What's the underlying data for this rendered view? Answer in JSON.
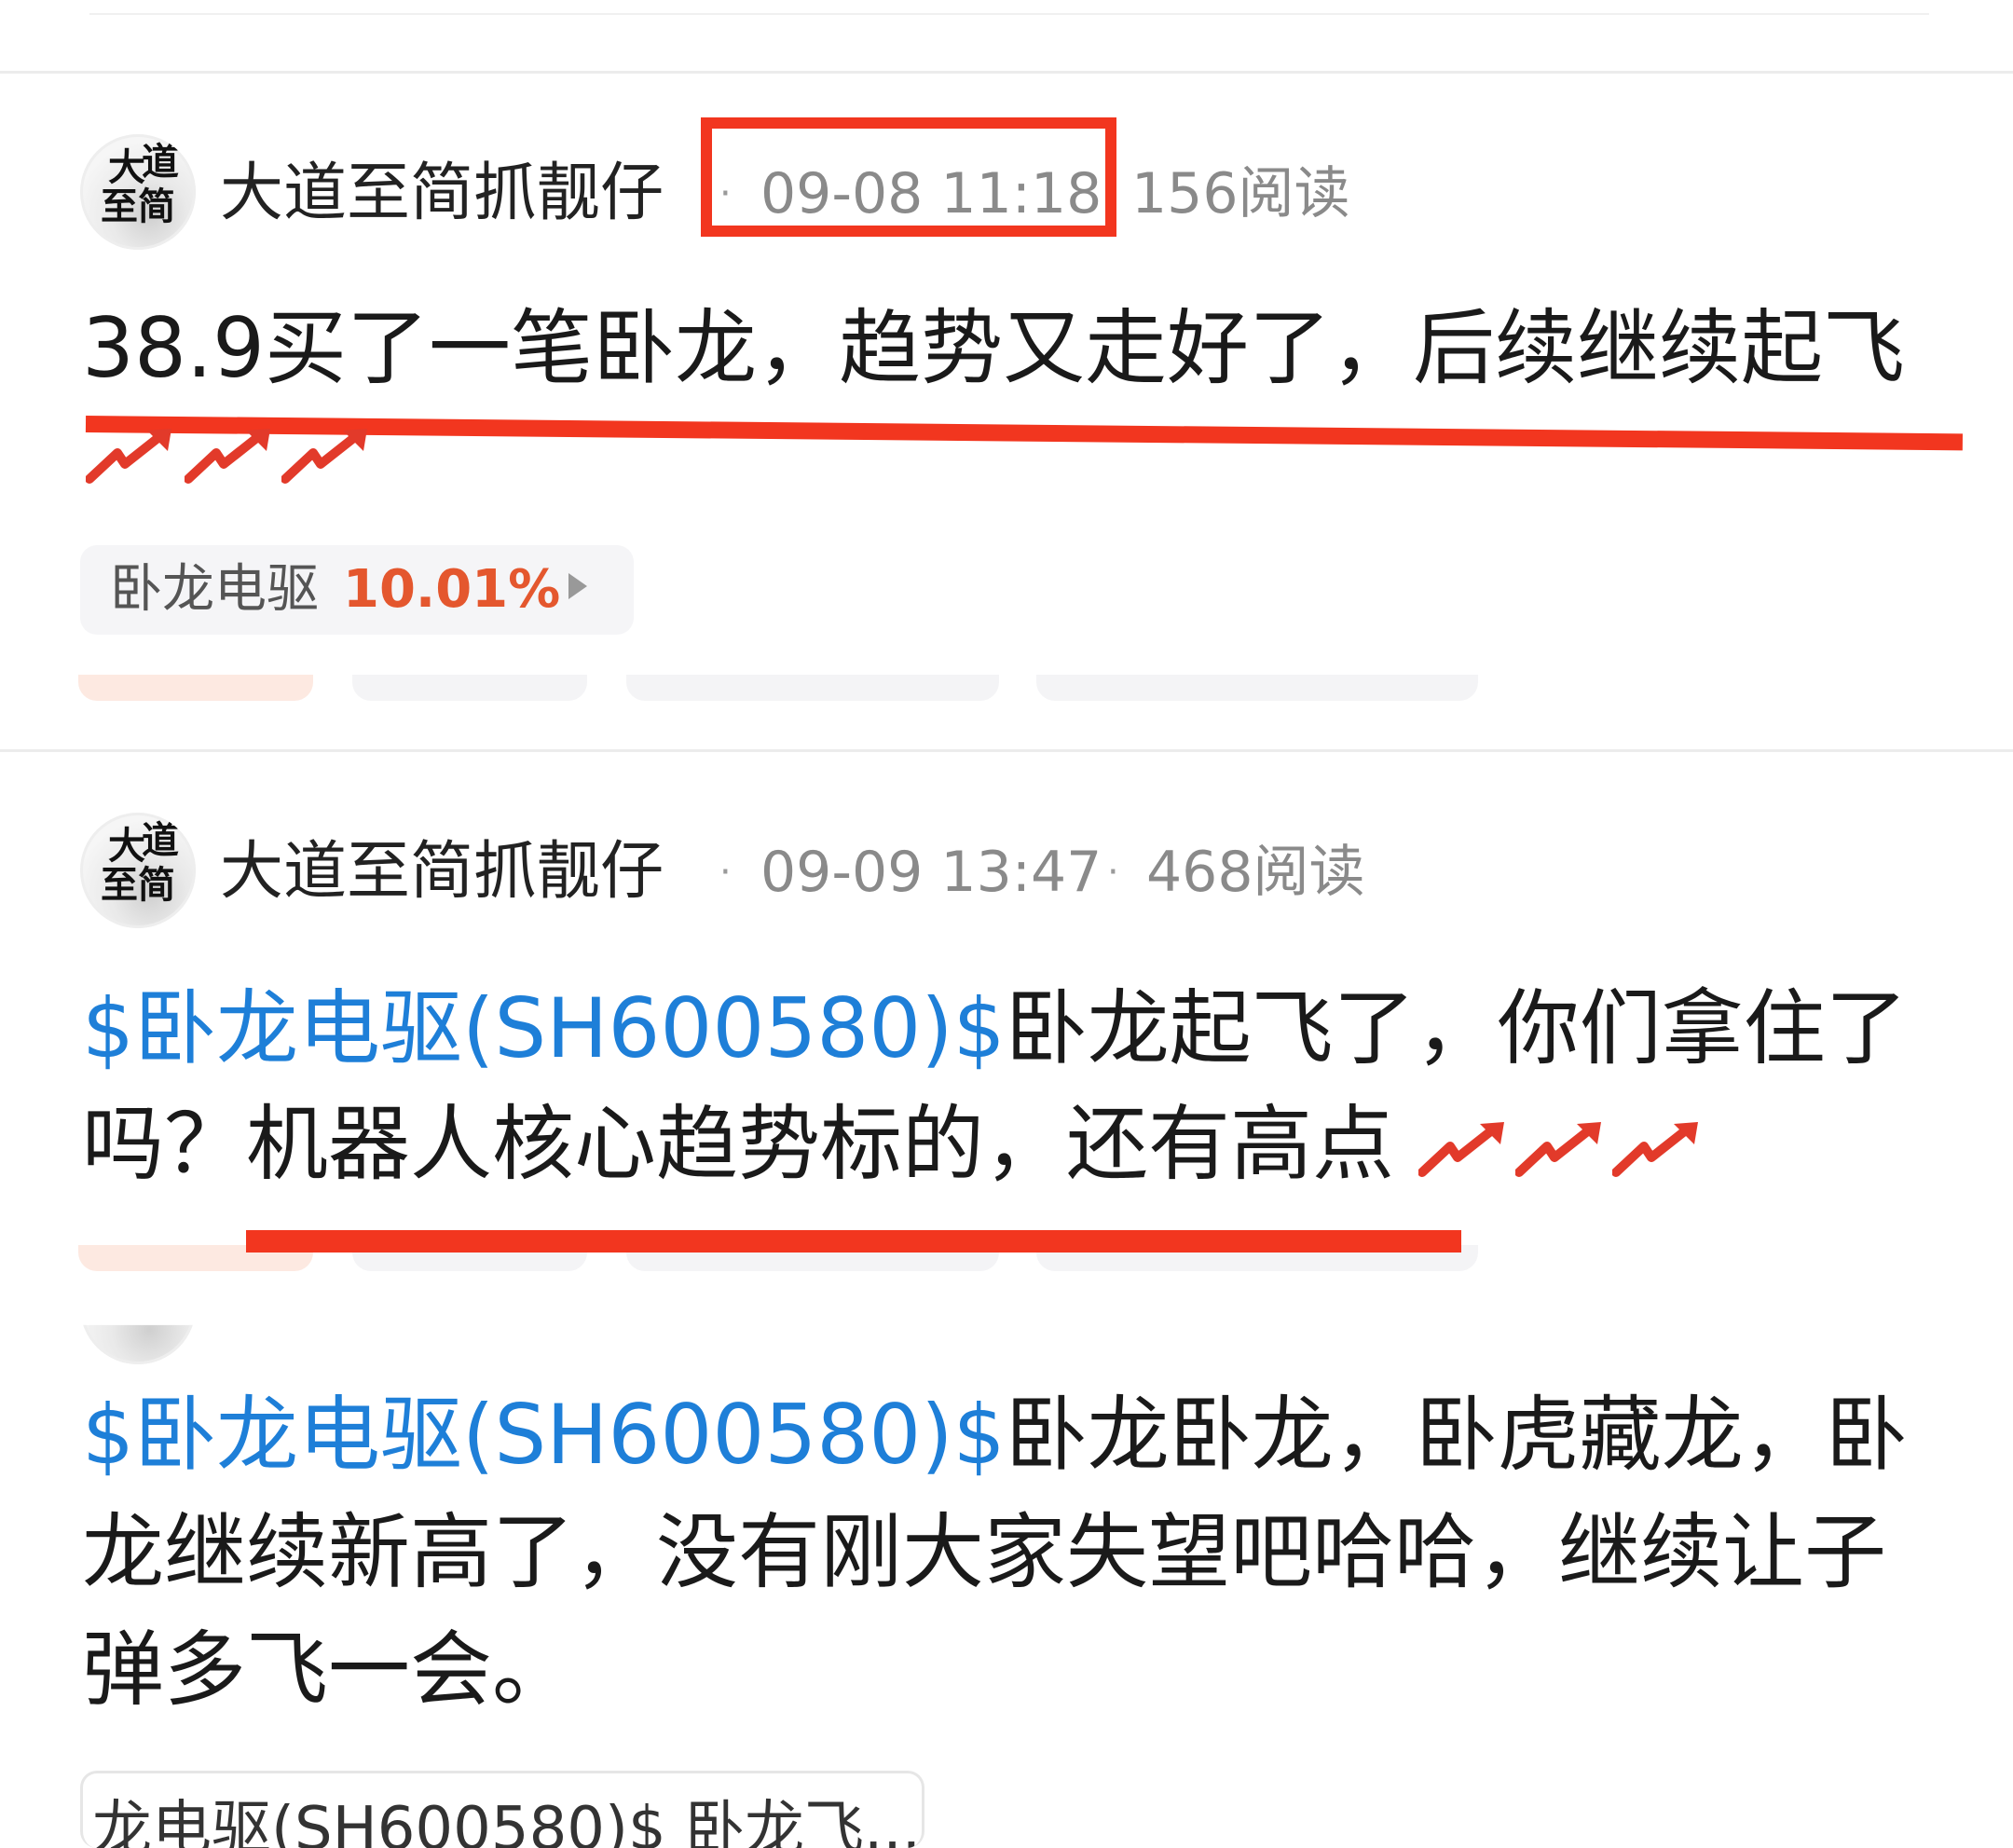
{
  "posts": [
    {
      "author": "大道至简抓靓仔",
      "avatar_chars": [
        "大",
        "道",
        "至",
        "简"
      ],
      "time": "09-08 11:18",
      "reads": "156阅读",
      "text": "38.9买了一笔卧龙，趋势又走好了，后续继续起飞",
      "stock_chip": {
        "name": "卧龙电驱",
        "change": "10.01%"
      }
    },
    {
      "author": "大道至简抓靓仔",
      "avatar_chars": [
        "大",
        "道",
        "至",
        "简"
      ],
      "time": "09-09 13:47",
      "reads": "468阅读",
      "stock_link": "$卧龙电驱(SH600580)$",
      "line1_rest": "卧龙起飞了，你们拿住了",
      "line2": "吗？机器人核心趋势标的，还有高点"
    },
    {
      "stock_link": "$卧龙电驱(SH600580)$",
      "line1_rest": "卧龙卧龙，卧虎藏龙，卧",
      "line2": "龙继续新高了，没有刚大家失望吧哈哈，继续让子",
      "line3": "弹多飞一会。",
      "quote_preview": "龙电驱(SH600580)$  卧龙飞..."
    }
  ],
  "icons": {
    "rocket": "rising-trend-arrow-icon",
    "chip_arrow": "play-triangle-icon"
  },
  "colors": {
    "link": "#1e7fd8",
    "rise": "#e4572e",
    "annotation": "#f2361f"
  }
}
